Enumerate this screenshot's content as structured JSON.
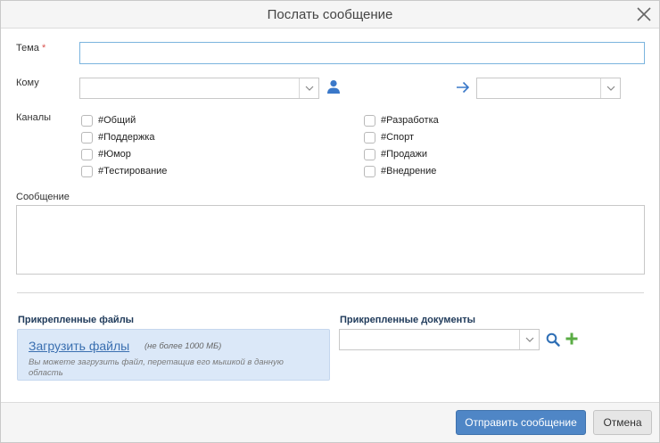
{
  "dialog": {
    "title": "Послать сообщение"
  },
  "form": {
    "subject_label": "Тема",
    "subject_required_mark": "*",
    "subject_value": "",
    "to_label": "Кому",
    "to_value": "",
    "forward_value": "",
    "channels_label": "Каналы",
    "channels": [
      {
        "label": "#Общий",
        "checked": false
      },
      {
        "label": "#Поддержка",
        "checked": false
      },
      {
        "label": "#Юмор",
        "checked": false
      },
      {
        "label": "#Тестирование",
        "checked": false
      },
      {
        "label": "#Разработка",
        "checked": false
      },
      {
        "label": "#Спорт",
        "checked": false
      },
      {
        "label": "#Продажи",
        "checked": false
      },
      {
        "label": "#Внедрение",
        "checked": false
      }
    ],
    "message_label": "Сообщение",
    "message_value": ""
  },
  "attachments": {
    "files_title": "Прикрепленные файлы",
    "upload_link": "Загрузить файлы",
    "upload_limit": "(не более 1000 МБ)",
    "upload_hint": "Вы можете загрузить файл, перетащив его мышкой в данную область",
    "docs_title": "Прикрепленные документы",
    "docs_value": ""
  },
  "footer": {
    "send_label": "Отправить сообщение",
    "cancel_label": "Отмена"
  },
  "colors": {
    "primary": "#4f86c6",
    "accent_blue": "#3a78c9",
    "add_green": "#5aac44",
    "required_red": "#d9534f"
  },
  "icons": {
    "close": "close-icon",
    "user": "user-icon",
    "arrow": "arrow-right-icon",
    "search": "search-icon",
    "add": "plus-icon",
    "dropdown": "chevron-down-icon"
  }
}
